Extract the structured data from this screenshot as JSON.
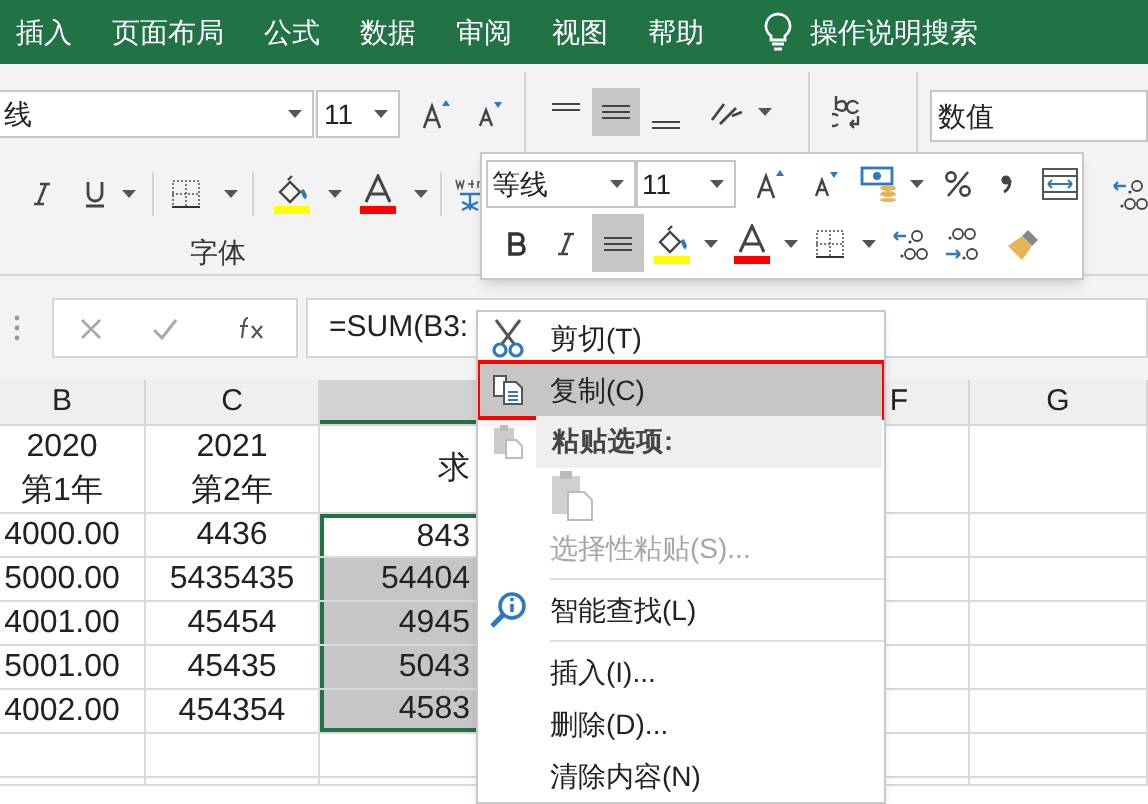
{
  "ribbon_tabs": [
    {
      "label": "插入",
      "selected": false
    },
    {
      "label": "页面布局",
      "selected": false
    },
    {
      "label": "公式",
      "selected": false
    },
    {
      "label": "数据",
      "selected": false
    },
    {
      "label": "审阅",
      "selected": false
    },
    {
      "label": "视图",
      "selected": false
    },
    {
      "label": "帮助",
      "selected": false
    }
  ],
  "tell_me": "操作说明搜索",
  "ribbon": {
    "font_name": "线",
    "font_size": "11",
    "number_format": "数值",
    "group_label": "字体",
    "middle_align_selected": true
  },
  "mini_toolbar": {
    "font_name": "等线",
    "font_size": "11",
    "center_align_selected": true
  },
  "formula_bar": {
    "formula": "=SUM(B3:"
  },
  "sheet": {
    "columns": [
      {
        "label": "B",
        "selected": false
      },
      {
        "label": "C",
        "selected": false
      },
      {
        "selected": true
      },
      {
        "label": "F",
        "selected": false
      },
      {
        "label": "G",
        "selected": false
      }
    ],
    "header_row": [
      {
        "lines": [
          "2020",
          "第1年"
        ]
      },
      {
        "lines": [
          "2021",
          "第2年"
        ]
      },
      {
        "lines": [
          "求"
        ]
      }
    ],
    "rows": [
      {
        "cells": [
          {
            "text": "4000.00",
            "shaded": false
          },
          {
            "text": "4436",
            "shaded": false
          },
          {
            "text": "843",
            "shaded": false
          }
        ]
      },
      {
        "cells": [
          {
            "text": "5000.00",
            "shaded": false
          },
          {
            "text": "5435435",
            "shaded": false
          },
          {
            "text": "54404",
            "shaded": true
          }
        ]
      },
      {
        "cells": [
          {
            "text": "4001.00",
            "shaded": false
          },
          {
            "text": "45454",
            "shaded": false
          },
          {
            "text": "4945",
            "shaded": true
          }
        ]
      },
      {
        "cells": [
          {
            "text": "5001.00",
            "shaded": false
          },
          {
            "text": "45435",
            "shaded": false
          },
          {
            "text": "5043",
            "shaded": true
          }
        ]
      },
      {
        "cells": [
          {
            "text": "4002.00",
            "shaded": false
          },
          {
            "text": "454354",
            "shaded": false
          },
          {
            "text": "4583",
            "shaded": true
          }
        ]
      }
    ]
  },
  "context_menu": [
    {
      "kind": "item",
      "label": "剪切(T)",
      "highlighted": false,
      "disabled": false
    },
    {
      "kind": "item",
      "label": "复制(C)",
      "highlighted": true,
      "disabled": false
    },
    {
      "kind": "header",
      "label": "粘贴选项:"
    },
    {
      "kind": "paste_options"
    },
    {
      "kind": "item",
      "label": "选择性粘贴(S)...",
      "highlighted": false,
      "disabled": true
    },
    {
      "kind": "separator"
    },
    {
      "kind": "item",
      "label": "智能查找(L)",
      "highlighted": false,
      "disabled": false
    },
    {
      "kind": "separator"
    },
    {
      "kind": "item",
      "label": "插入(I)...",
      "highlighted": false,
      "disabled": false
    },
    {
      "kind": "item",
      "label": "删除(D)...",
      "highlighted": false,
      "disabled": false
    },
    {
      "kind": "item",
      "label": "清除内容(N)",
      "highlighted": false,
      "disabled": false
    }
  ]
}
